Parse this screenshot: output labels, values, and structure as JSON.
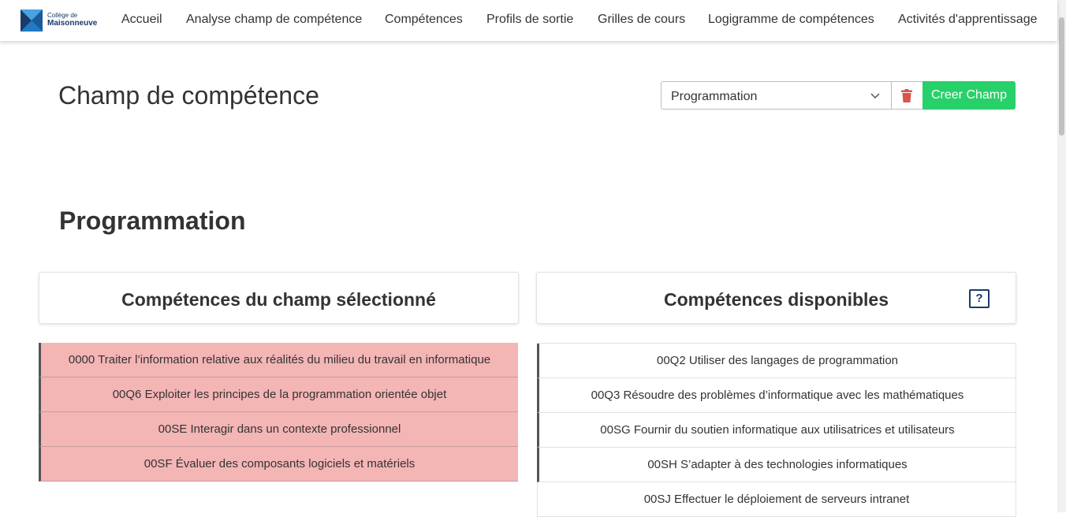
{
  "brand": {
    "line1": "Collège de",
    "line2": "Maisonneuve",
    "primary_color": "#1a3a6b",
    "accent_color": "#1e7bc4"
  },
  "nav": [
    {
      "label": "Accueil"
    },
    {
      "label": "Analyse champ de compétence"
    },
    {
      "label": "Compétences"
    },
    {
      "label": "Profils de sortie"
    },
    {
      "label": "Grilles de cours"
    },
    {
      "label": "Logigramme de compétences"
    },
    {
      "label": "Activités d'apprentissage"
    }
  ],
  "header": {
    "title": "Champ de compétence",
    "select_value": "Programmation",
    "delete_icon": "trash-icon",
    "create_label": "Creer Champ",
    "create_color": "#28d06a",
    "delete_color": "#d9534f"
  },
  "section_title": "Programmation",
  "selected_card": {
    "title": "Compétences du champ sélectionné",
    "items": [
      {
        "label": "0000 Traiter l’information relative aux réalités du milieu du travail en informatique"
      },
      {
        "label": "00Q6 Exploiter les principes de la programmation orientée objet"
      },
      {
        "label": "00SE Interagir dans un contexte professionnel"
      },
      {
        "label": "00SF Évaluer des composants logiciels et matériels"
      }
    ],
    "item_color": "#f4b5b5"
  },
  "available_card": {
    "title": "Compétences disponibles",
    "help_label": "?",
    "items": [
      {
        "label": "00Q2 Utiliser des langages de programmation"
      },
      {
        "label": "00Q3 Résoudre des problèmes d’informatique avec les mathématiques"
      },
      {
        "label": "00SG Fournir du soutien informatique aux utilisatrices et utilisateurs"
      },
      {
        "label": "00SH S’adapter à des technologies informatiques"
      },
      {
        "label": "00SJ Effectuer le déploiement de serveurs intranet"
      }
    ]
  }
}
